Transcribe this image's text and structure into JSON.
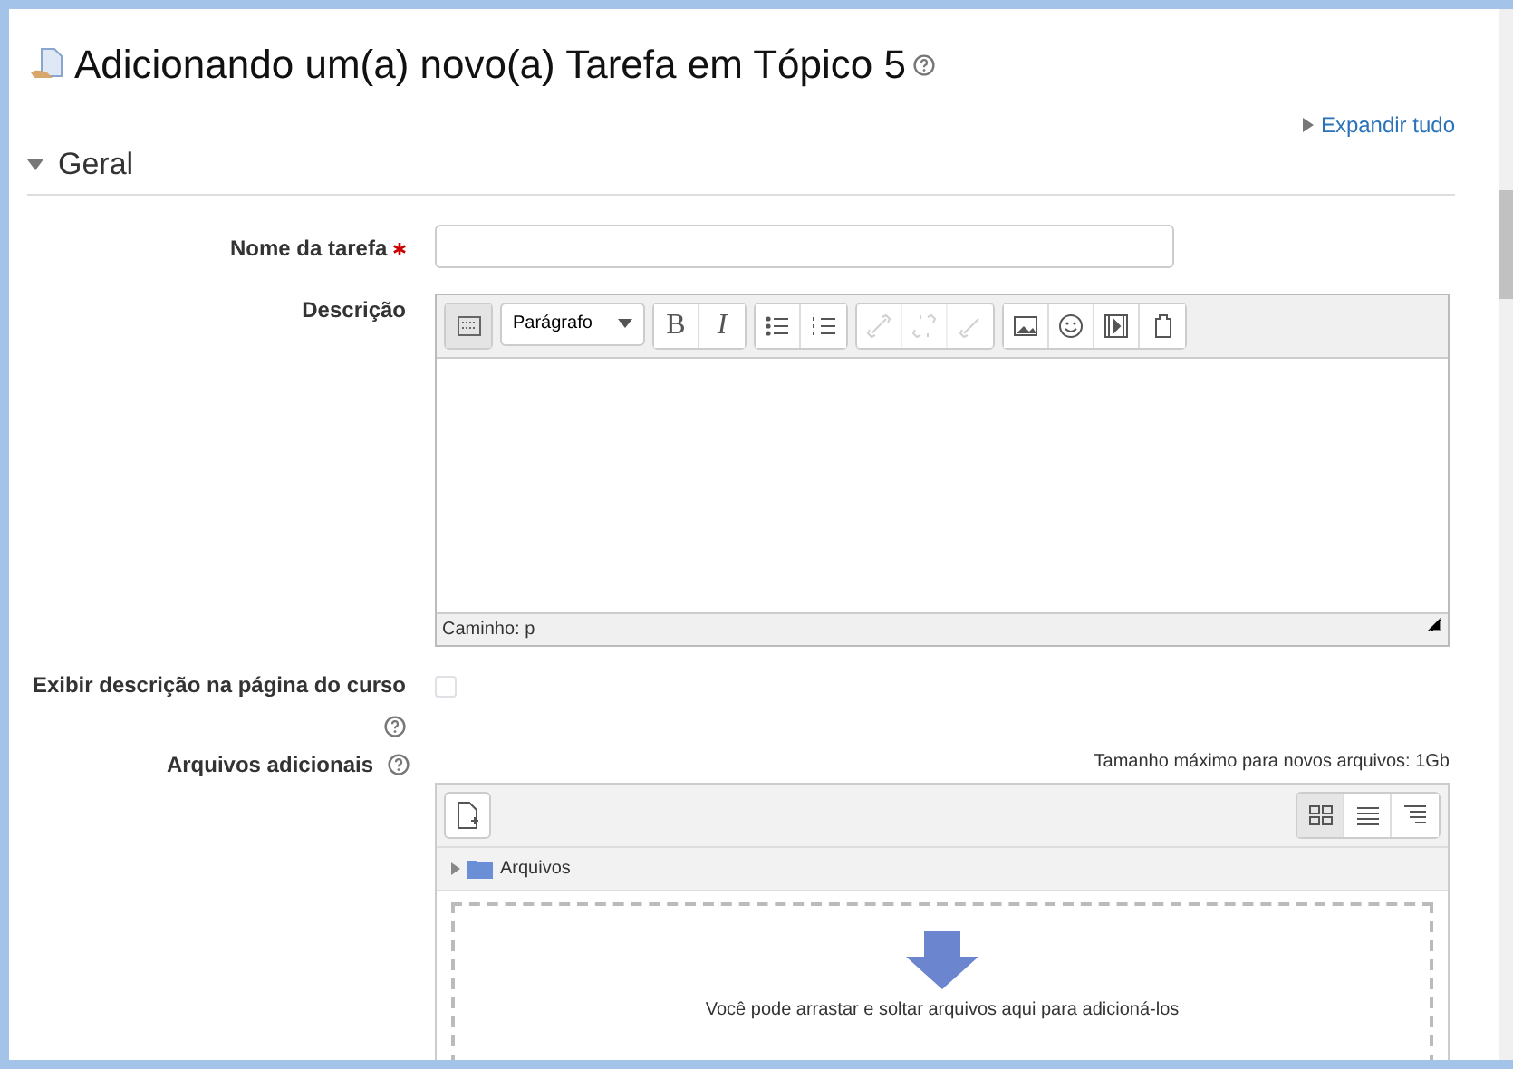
{
  "title": "Adicionando um(a) novo(a) Tarefa em Tópico 5",
  "expand_all": "Expandir tudo",
  "section": {
    "title": "Geral",
    "expanded": true
  },
  "name_field": {
    "label": "Nome da tarefa",
    "required": true
  },
  "description": {
    "label": "Descrição",
    "format": "Parágrafo",
    "path": "Caminho: p",
    "toolbar": [
      {
        "kind": "toggle",
        "disabled": false
      },
      {
        "kind": "bold",
        "text": "B",
        "disabled": false
      },
      {
        "kind": "italic",
        "text": "I",
        "disabled": false
      },
      {
        "kind": "bullets",
        "disabled": false
      },
      {
        "kind": "numbers",
        "disabled": false
      },
      {
        "kind": "link",
        "disabled": true
      },
      {
        "kind": "unlink",
        "disabled": true
      },
      {
        "kind": "anchor",
        "disabled": true
      },
      {
        "kind": "image",
        "disabled": false
      },
      {
        "kind": "emoticon",
        "disabled": false
      },
      {
        "kind": "media",
        "disabled": false
      },
      {
        "kind": "paste",
        "disabled": false
      }
    ]
  },
  "show_description": {
    "label": "Exibir descrição na página do curso",
    "checked": false
  },
  "files": {
    "label": "Arquivos adicionais",
    "max_size": "Tamanho máximo para novos arquivos: 1Gb",
    "folder": "Arquivos",
    "drop_hint": "Você pode arrastar e soltar arquivos aqui para adicioná-los",
    "views": [
      {
        "kind": "icons",
        "selected": true
      },
      {
        "kind": "list",
        "selected": false
      },
      {
        "kind": "tree",
        "selected": false
      }
    ]
  }
}
